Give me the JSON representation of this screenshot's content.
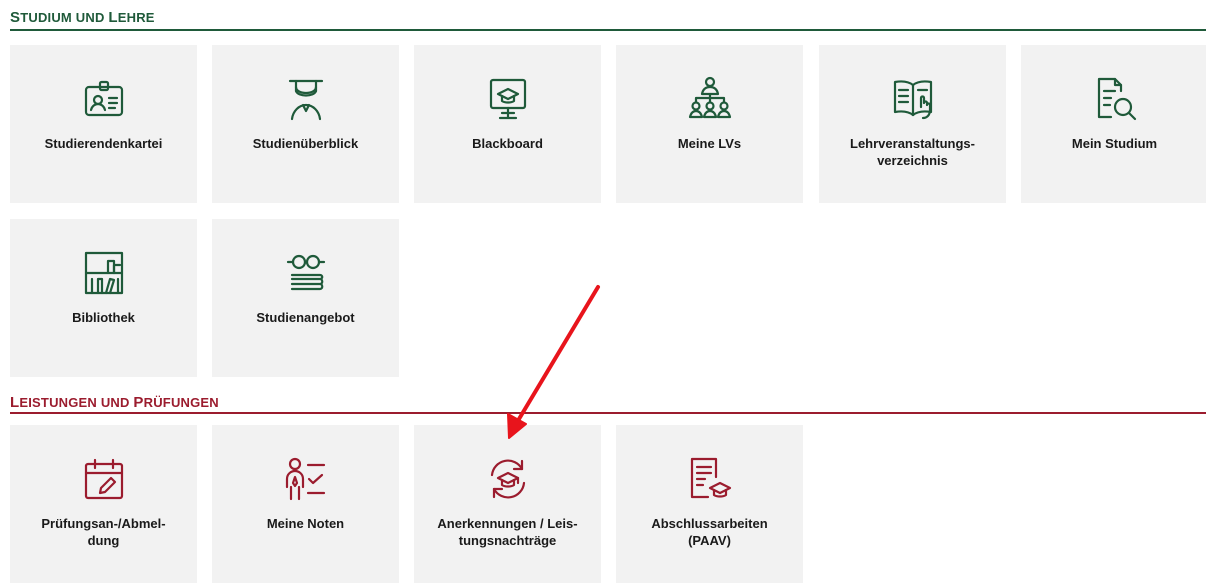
{
  "sections": [
    {
      "title_first": "S",
      "title_rest": "TUDIUM UND ",
      "title_first2": "L",
      "title_rest2": "EHRE",
      "color": "#1f5a3a",
      "tiles": [
        {
          "label": "Studierendenkartei",
          "icon": "student-id-card-icon"
        },
        {
          "label": "Studienüberblick",
          "icon": "graduate-icon"
        },
        {
          "label": "Blackboard",
          "icon": "presentation-board-icon"
        },
        {
          "label": "Meine LVs",
          "icon": "org-chart-people-icon"
        },
        {
          "label": "Lehrveranstaltungs-\nverzeichnis",
          "icon": "open-book-icon"
        },
        {
          "label": "Mein Studium",
          "icon": "document-search-icon"
        },
        {
          "label": "Bibliothek",
          "icon": "bookshelf-icon"
        },
        {
          "label": "Studienangebot",
          "icon": "glasses-books-icon"
        }
      ]
    },
    {
      "title_first": "L",
      "title_rest": "EISTUNGEN UND ",
      "title_first2": "P",
      "title_rest2": "RÜFUNGEN",
      "color": "#9b1c2e",
      "tiles": [
        {
          "label": "Prüfungsan-/Abmel-\ndung",
          "icon": "calendar-edit-icon"
        },
        {
          "label": "Meine Noten",
          "icon": "person-checklist-icon"
        },
        {
          "label": "Anerkennungen / Leis-\ntungsnachträge",
          "icon": "graduation-cap-refresh-icon"
        },
        {
          "label": "Abschlussarbeiten\n(PAAV)",
          "icon": "document-graduation-icon"
        }
      ]
    }
  ],
  "annotation": {
    "type": "red-arrow",
    "color": "#e8141c",
    "points_to": "Anerkennungen / Leistungsnachträge"
  }
}
